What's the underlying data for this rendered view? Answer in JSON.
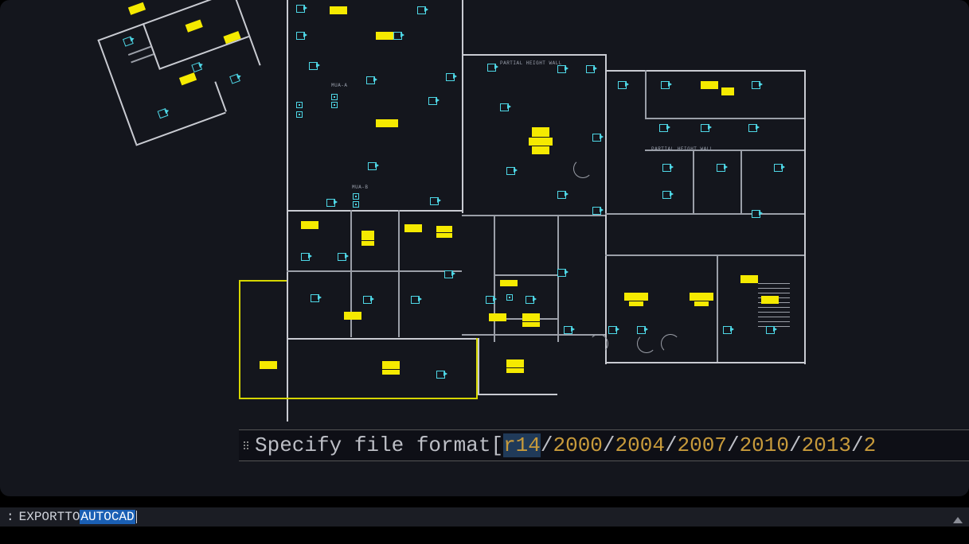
{
  "labels": {
    "partial_height_wall": "PARTIAL HEIGHT WALL",
    "mua_a": "MUA-A",
    "mua_b": "MUA-B"
  },
  "prompt": {
    "text": "Specify file format ",
    "bracket_open": "[",
    "bracket_close": "/",
    "options": [
      "r14",
      "2000",
      "2004",
      "2007",
      "2010",
      "2013",
      "2"
    ],
    "separator": "/"
  },
  "command": {
    "prefix": ": ",
    "typed": "EXPORTTO",
    "autocomplete": "AUTOCAD"
  },
  "symbols": {
    "camera_icon": "camera-icon",
    "sensor_icon": "sensor-icon"
  },
  "colors": {
    "bg": "#14161d",
    "wall": "#c9cbd2",
    "highlight": "#f5ea00",
    "device": "#4ed7e6",
    "option": "#c79a3b",
    "autocomplete_bg": "#1a5fb4"
  }
}
